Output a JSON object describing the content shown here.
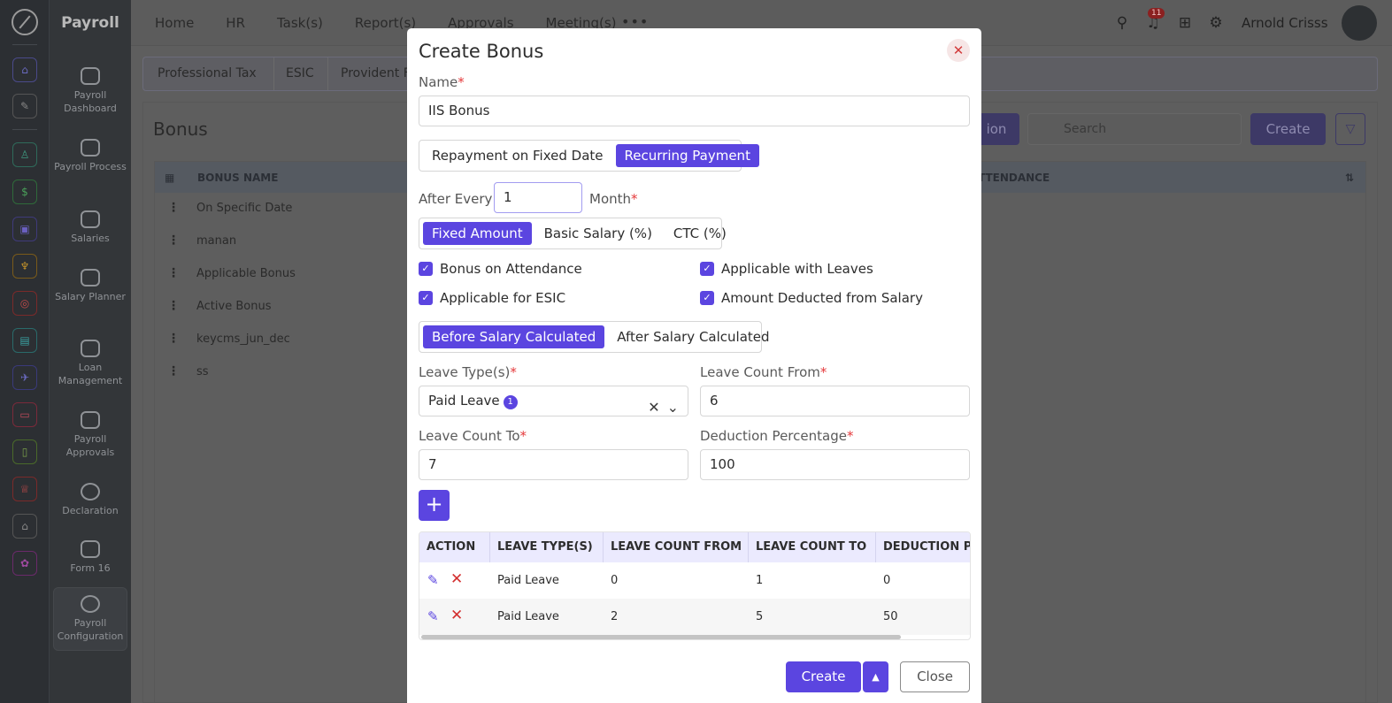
{
  "app": {
    "title": "Payroll"
  },
  "topnav": [
    "Home",
    "HR",
    "Task(s)",
    "Report(s)",
    "Approvals",
    "Meeting(s)"
  ],
  "topbar": {
    "notification_count": "11",
    "user_name": "Arnold Crisss"
  },
  "sidebar": {
    "items": [
      {
        "label": "Payroll Dashboard"
      },
      {
        "label": "Payroll Process"
      },
      {
        "label": "Salaries"
      },
      {
        "label": "Salary Planner"
      },
      {
        "label": "Loan Management"
      },
      {
        "label": "Payroll Approvals"
      },
      {
        "label": "Declaration"
      },
      {
        "label": "Form 16"
      },
      {
        "label": "Payroll Configuration"
      }
    ]
  },
  "background": {
    "tabs": [
      "Professional Tax",
      "ESIC",
      "Provident F"
    ],
    "page_title": "Bonus",
    "partial_button": "ion",
    "search_placeholder": "Search",
    "create_label": "Create",
    "columns": [
      "BONUS NAME",
      "TTENDANCE"
    ],
    "rows": [
      "On Specific Date",
      "manan",
      "Applicable Bonus",
      "Active Bonus",
      "keycms_jun_dec",
      "ss"
    ]
  },
  "modal": {
    "title": "Create Bonus",
    "name_label": "Name",
    "name_value": "IIS Bonus",
    "payment_options": [
      "Repayment on Fixed Date",
      "Recurring Payment"
    ],
    "payment_selected": "Recurring Payment",
    "after_every_label": "After Every",
    "after_every_value": "1",
    "month_label": "Month",
    "amount_options": [
      "Fixed Amount",
      "Basic Salary (%)",
      "CTC (%)"
    ],
    "amount_selected": "Fixed Amount",
    "checkboxes": [
      {
        "label": "Bonus on Attendance",
        "checked": true
      },
      {
        "label": "Applicable with Leaves",
        "checked": true
      },
      {
        "label": "Applicable for ESIC",
        "checked": true
      },
      {
        "label": "Amount Deducted from Salary",
        "checked": true
      }
    ],
    "salary_options": [
      "Before Salary Calculated",
      "After Salary Calculated"
    ],
    "salary_selected": "Before Salary Calculated",
    "leave_types_label": "Leave Type(s)",
    "leave_types_value": "Paid Leave",
    "leave_types_count": "1",
    "leave_from_label": "Leave Count From",
    "leave_from_value": "6",
    "leave_to_label": "Leave Count To",
    "leave_to_value": "7",
    "deduction_label": "Deduction Percentage",
    "deduction_value": "100",
    "table": {
      "columns": [
        "ACTION",
        "LEAVE TYPE(S)",
        "LEAVE COUNT FROM",
        "LEAVE COUNT TO",
        "DEDUCTION PE"
      ],
      "rows": [
        {
          "type": "Paid Leave",
          "from": "0",
          "to": "1",
          "deduction": "0"
        },
        {
          "type": "Paid Leave",
          "from": "2",
          "to": "5",
          "deduction": "50"
        }
      ]
    },
    "create_button": "Create",
    "close_button": "Close"
  },
  "colors": {
    "accent": "#5b45e0",
    "danger": "#d32f2f"
  }
}
